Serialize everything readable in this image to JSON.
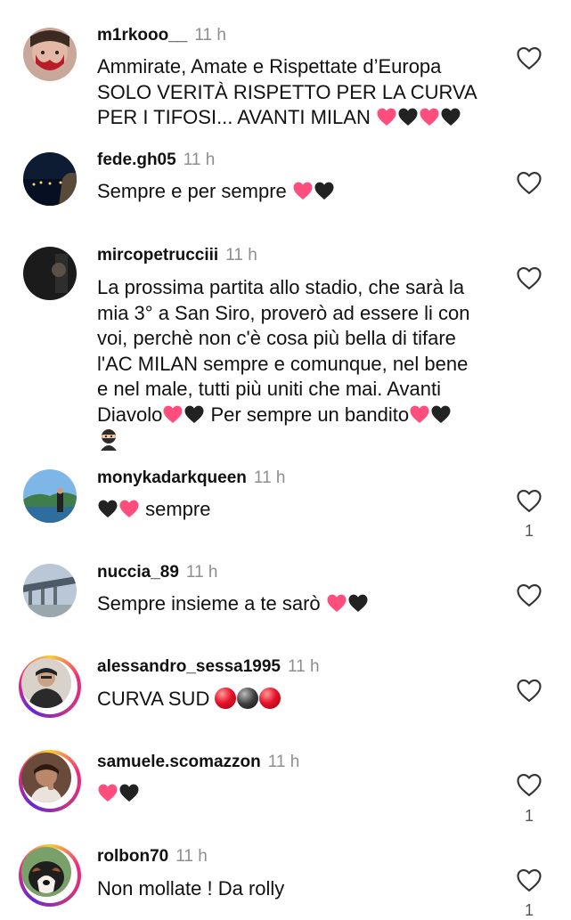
{
  "comments": [
    {
      "user": "m1rkooo__",
      "time": "11 h",
      "lines": [
        "Ammirate, Amate e Rispettate d’Europa",
        "SOLO VERITÀ RISPETTO PER LA CURVA",
        "PER I TIFOSI... AVANTI MILAN"
      ],
      "likes": ""
    },
    {
      "user": "fede.gh05",
      "time": "11 h",
      "lines": [
        "Sempre e per sempre"
      ],
      "likes": ""
    },
    {
      "user": "mircopetrucciii",
      "time": "11 h",
      "lines": [
        "La prossima partita allo stadio, che sarà la",
        "mia 3° a San Siro, proverò ad essere li con",
        "voi, perchè non c'è cosa più bella di tifare",
        "l'AC MILAN sempre e comunque, nel bene",
        "e nel male, tutti più uniti che mai. Avanti",
        "Diavolo",
        "Per sempre un bandito"
      ],
      "likes": ""
    },
    {
      "user": "monykadarkqueen",
      "time": "11 h",
      "lines": [
        "sempre"
      ],
      "likes": "1"
    },
    {
      "user": "nuccia_89",
      "time": "11 h",
      "lines": [
        "Sempre insieme a te sarò"
      ],
      "likes": ""
    },
    {
      "user": "alessandro_sessa1995",
      "time": "11 h",
      "lines": [
        "CURVA SUD"
      ],
      "likes": ""
    },
    {
      "user": "samuele.scomazzon",
      "time": "11 h",
      "lines": [
        ""
      ],
      "likes": "1"
    },
    {
      "user": "rolbon70",
      "time": "11 h",
      "lines": [
        "Non mollate ! Da rolly"
      ],
      "likes": "1"
    }
  ],
  "icons": {
    "like": "heart-outline-icon",
    "red_heart": "pink-heart-emoji",
    "black_heart": "black-heart-emoji",
    "red_ball": "red-circle-emoji",
    "black_ball": "black-circle-emoji",
    "ninja": "ninja-emoji"
  },
  "colors": {
    "text": "#111111",
    "muted": "#8e8e8e",
    "pink_heart": "#ff4d7e",
    "black_heart": "#222222"
  }
}
